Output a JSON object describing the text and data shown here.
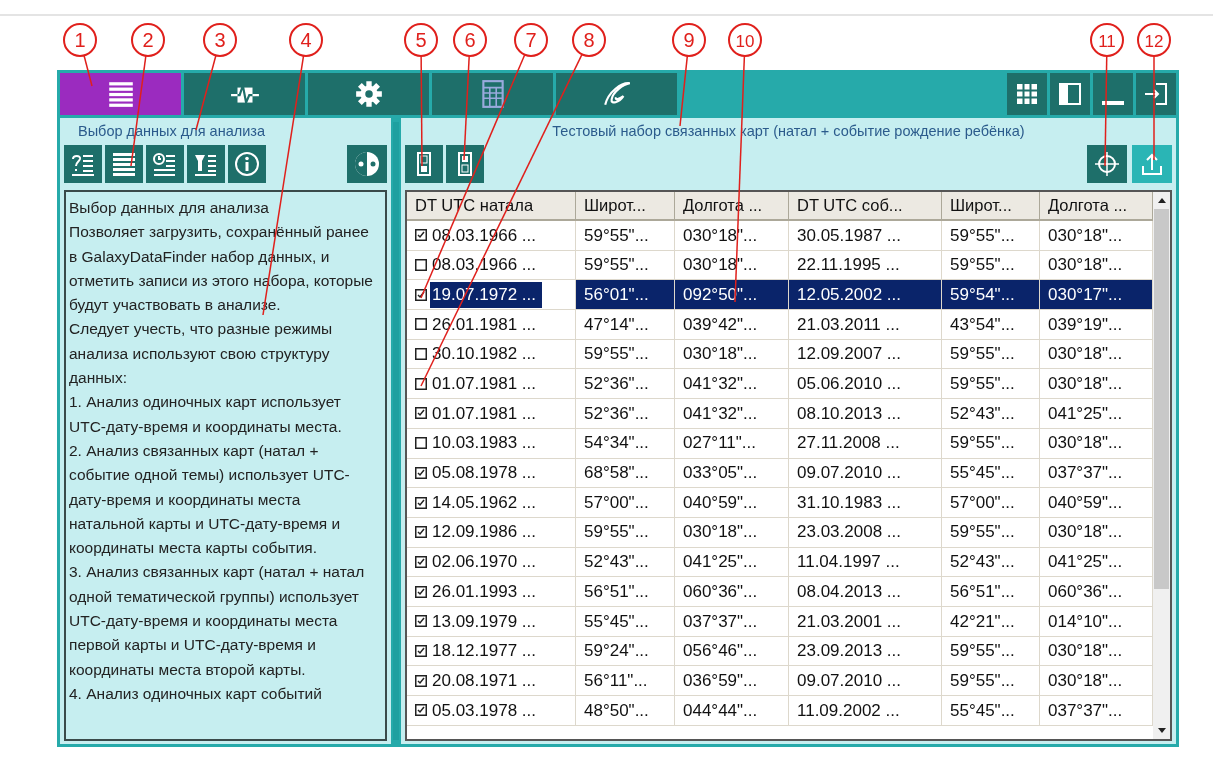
{
  "callouts": [
    {
      "label": "1"
    },
    {
      "label": "2"
    },
    {
      "label": "3"
    },
    {
      "label": "4"
    },
    {
      "label": "5"
    },
    {
      "label": "6"
    },
    {
      "label": "7"
    },
    {
      "label": "8"
    },
    {
      "label": "9"
    },
    {
      "label": "10"
    },
    {
      "label": "11"
    },
    {
      "label": "12"
    }
  ],
  "tabs": [
    {
      "kind": "list",
      "selected": true
    },
    {
      "kind": "pulse",
      "selected": false
    },
    {
      "kind": "gear",
      "selected": false
    },
    {
      "kind": "grid",
      "selected": false
    },
    {
      "kind": "spiral",
      "selected": false
    }
  ],
  "window_buttons": [
    {
      "kind": "tiles"
    },
    {
      "kind": "panel"
    },
    {
      "kind": "minimize"
    },
    {
      "kind": "exit"
    }
  ],
  "left_panel": {
    "title": "Выбор данных для анализа",
    "toolbar": [
      {
        "kind": "help"
      },
      {
        "kind": "list"
      },
      {
        "kind": "clock"
      },
      {
        "kind": "filter"
      },
      {
        "kind": "info"
      }
    ],
    "toolbar_right": [
      {
        "kind": "split"
      }
    ],
    "description": [
      "Выбор данных для анализа",
      "Позволяет загрузить, сохранённый ранее в GalaxyDataFinder набор данных, и отметить записи из этого набора, которые будут участвовать в анализе.",
      "Следует учесть, что разные режимы анализа используют свою структуру данных:",
      "1. Анализ одиночных карт использует UTC-дату-время и координаты места.",
      "2. Анализ связанных карт (натал + событие одной темы) использует UTC-дату-время и координаты места натальной карты и UTC-дату-время и координаты места карты события.",
      "3. Анализ связанных карт (натал + натал одной тематической  группы) использует UTC-дату-время и координаты места первой карты и UTC-дату-время и координаты места второй карты.",
      "4. Анализ одиночных карт событий"
    ]
  },
  "right_panel": {
    "title": "Тестовый набор связанных карт (натал + событие рождение ребёнка)",
    "toolbar": [
      {
        "kind": "top"
      },
      {
        "kind": "bottom"
      }
    ],
    "toolbar_right": [
      {
        "kind": "crosshair"
      },
      {
        "kind": "upload"
      }
    ],
    "table": {
      "columns": [
        "DT UTC натала",
        "Широт...",
        "Долгота ...",
        "DT UTC соб...",
        "Широт...",
        "Долгота ..."
      ],
      "rows": [
        {
          "checked": true,
          "selected": false,
          "cells": [
            "08.03.1966 ...",
            "59°55\"...",
            "030°18\"...",
            "30.05.1987 ...",
            "59°55\"...",
            "030°18\"..."
          ]
        },
        {
          "checked": false,
          "selected": false,
          "cells": [
            "08.03.1966 ...",
            "59°55\"...",
            "030°18\"...",
            "22.11.1995 ...",
            "59°55\"...",
            "030°18\"..."
          ]
        },
        {
          "checked": true,
          "selected": true,
          "cells": [
            "19.07.1972 ...",
            "56°01\"...",
            "092°50\"...",
            "12.05.2002 ...",
            "59°54\"...",
            "030°17\"..."
          ]
        },
        {
          "checked": false,
          "selected": false,
          "cells": [
            "26.01.1981 ...",
            "47°14\"...",
            "039°42\"...",
            "21.03.2011 ...",
            "43°54\"...",
            "039°19\"..."
          ]
        },
        {
          "checked": false,
          "selected": false,
          "cells": [
            "30.10.1982 ...",
            "59°55\"...",
            "030°18\"...",
            "12.09.2007 ...",
            "59°55\"...",
            "030°18\"..."
          ]
        },
        {
          "checked": false,
          "selected": false,
          "cells": [
            "01.07.1981 ...",
            "52°36\"...",
            "041°32\"...",
            "05.06.2010 ...",
            "59°55\"...",
            "030°18\"..."
          ]
        },
        {
          "checked": true,
          "selected": false,
          "cells": [
            "01.07.1981 ...",
            "52°36\"...",
            "041°32\"...",
            "08.10.2013 ...",
            "52°43\"...",
            "041°25\"..."
          ]
        },
        {
          "checked": false,
          "selected": false,
          "cells": [
            "10.03.1983 ...",
            "54°34\"...",
            "027°11\"...",
            "27.11.2008 ...",
            "59°55\"...",
            "030°18\"..."
          ]
        },
        {
          "checked": true,
          "selected": false,
          "cells": [
            "05.08.1978 ...",
            "68°58\"...",
            "033°05\"...",
            "09.07.2010 ...",
            "55°45\"...",
            "037°37\"..."
          ]
        },
        {
          "checked": true,
          "selected": false,
          "cells": [
            "14.05.1962 ...",
            "57°00\"...",
            "040°59\"...",
            "31.10.1983 ...",
            "57°00\"...",
            "040°59\"..."
          ]
        },
        {
          "checked": true,
          "selected": false,
          "cells": [
            "12.09.1986 ...",
            "59°55\"...",
            "030°18\"...",
            "23.03.2008 ...",
            "59°55\"...",
            "030°18\"..."
          ]
        },
        {
          "checked": true,
          "selected": false,
          "cells": [
            "02.06.1970 ...",
            "52°43\"...",
            "041°25\"...",
            "11.04.1997 ...",
            "52°43\"...",
            "041°25\"..."
          ]
        },
        {
          "checked": true,
          "selected": false,
          "cells": [
            "26.01.1993 ...",
            "56°51\"...",
            "060°36\"...",
            "08.04.2013 ...",
            "56°51\"...",
            "060°36\"..."
          ]
        },
        {
          "checked": true,
          "selected": false,
          "cells": [
            "13.09.1979 ...",
            "55°45\"...",
            "037°37\"...",
            "21.03.2001 ...",
            "42°21\"...",
            "014°10\"..."
          ]
        },
        {
          "checked": true,
          "selected": false,
          "cells": [
            "18.12.1977 ...",
            "59°24\"...",
            "056°46\"...",
            "23.09.2013 ...",
            "59°55\"...",
            "030°18\"..."
          ]
        },
        {
          "checked": true,
          "selected": false,
          "cells": [
            "20.08.1971 ...",
            "56°11\"...",
            "036°59\"...",
            "09.07.2010 ...",
            "59°55\"...",
            "030°18\"..."
          ]
        },
        {
          "checked": true,
          "selected": false,
          "cells": [
            "05.03.1978 ...",
            "48°50\"...",
            "044°44\"...",
            "11.09.2002 ...",
            "55°45\"...",
            "037°37\"..."
          ]
        }
      ]
    }
  }
}
